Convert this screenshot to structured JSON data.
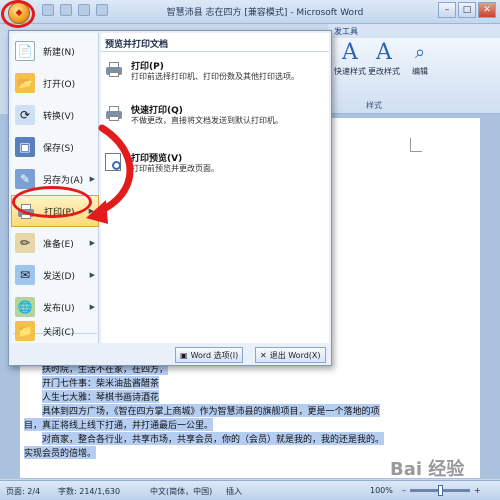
{
  "window": {
    "title": "智慧沛县 志在四方 [兼容模式] - Microsoft Word",
    "minimize": "–",
    "maximize": "□",
    "close": "✕"
  },
  "ribbon": {
    "tab_partial": "发工具",
    "quick_styles": "快速样式",
    "change_styles": "更改样式",
    "edit": "编辑",
    "styles_group": "样式",
    "style_glyph": "A"
  },
  "office_menu": {
    "left_items": [
      {
        "label": "新建(N)",
        "icon": "new-doc-icon",
        "has_arrow": false
      },
      {
        "label": "打开(O)",
        "icon": "open-folder-icon",
        "has_arrow": false
      },
      {
        "label": "转换(V)",
        "icon": "convert-icon",
        "has_arrow": false
      },
      {
        "label": "保存(S)",
        "icon": "save-icon",
        "has_arrow": false
      },
      {
        "label": "另存为(A)",
        "icon": "save-as-icon",
        "has_arrow": true
      },
      {
        "label": "打印(P)",
        "icon": "printer-icon",
        "has_arrow": true,
        "active": true
      },
      {
        "label": "准备(E)",
        "icon": "prepare-icon",
        "has_arrow": true
      },
      {
        "label": "发送(D)",
        "icon": "send-icon",
        "has_arrow": true
      },
      {
        "label": "发布(U)",
        "icon": "publish-icon",
        "has_arrow": true
      },
      {
        "label": "关闭(C)",
        "icon": "close-folder-icon",
        "has_arrow": false
      }
    ],
    "right_panel": {
      "title": "预览并打印文档",
      "options": [
        {
          "name": "打印(P)",
          "desc": "打印前选择打印机、打印份数及其他打印选项。",
          "icon": "printer-icon"
        },
        {
          "name": "快速打印(Q)",
          "desc": "不做更改，直接将文档发送到默认打印机。",
          "icon": "quick-print-icon"
        },
        {
          "name": "打印预览(V)",
          "desc": "打印前预览并更改页面。",
          "icon": "print-preview-icon"
        }
      ]
    },
    "word_options": "Word 选项(I)",
    "exit_word": "退出 Word(X)"
  },
  "document": {
    "lines": [
      "扶时院，生活不在家，在四方，",
      "开门七件事：柴米油盐酱醋茶",
      "人生七大雅：琴棋书画诗酒花",
      "具体到四方广场，《智在四方掌上商城》作为智慧沛县的旗舰项目，更是一个落地的项",
      "目，真正将线上线下打通，并打通最后一公里。",
      "对商家，整合各行业，共享市场，共享会员，你的（会员）就是我的，我的还是我的。",
      "实现会员的倍增。"
    ]
  },
  "status_bar": {
    "page": "页面: 2/4",
    "words": "字数: 214/1,630",
    "language": "中文(简体，中国)",
    "insert": "插入",
    "zoom": "100%",
    "zoom_minus": "–",
    "zoom_plus": "+",
    "zoom_level": 0.5
  },
  "watermark": "Bai 经验",
  "colors": {
    "annotation_red": "#e31b1b",
    "menu_highlight": "#ffd978"
  }
}
